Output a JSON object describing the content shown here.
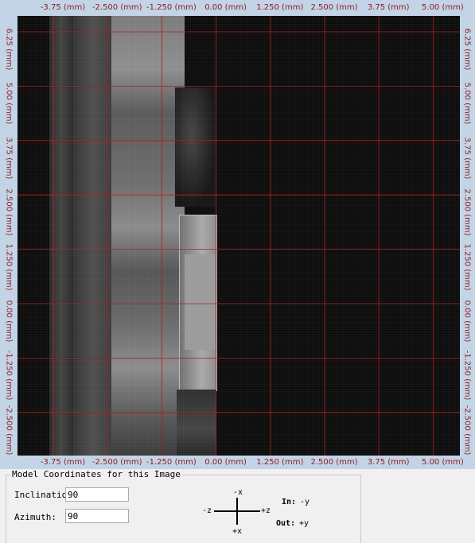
{
  "axes": {
    "top_ticks": [
      "-3.75 (mm)",
      "-2.500 (mm)",
      "-1.250 (mm)",
      "0.00 (mm)",
      "1.250 (mm)",
      "2.500 (mm)",
      "3.75 (mm)",
      "5.00 (mm)"
    ],
    "bottom_ticks": [
      "-3.75 (mm)",
      "-2.500 (mm)",
      "-1.250 (mm)",
      "0.00 (mm)",
      "1.250 (mm)",
      "2.500 (mm)",
      "3.75 (mm)",
      "5.00 (mm)"
    ],
    "left_ticks": [
      "6.25 (mm)",
      "5.00 (mm)",
      "3.75 (mm)",
      "2.500 (mm)",
      "1.250 (mm)",
      "0.00 (mm)",
      "-1.250 (mm)",
      "-2.500 (mm)"
    ],
    "right_ticks": [
      "6.25 (mm)",
      "5.00 (mm)",
      "3.75 (mm)",
      "2.500 (mm)",
      "1.250 (mm)",
      "0.00 (mm)",
      "-1.250 (mm)",
      "-2.500 (mm)"
    ],
    "grid_color": "#b02020",
    "label_color": "#8b1c1c"
  },
  "panel": {
    "title": "Model Coordinates for this Image",
    "inclination_label": "Inclination:",
    "inclination_value": "90",
    "azimuth_label": "Azimuth:",
    "azimuth_value": "90",
    "compass": {
      "top": "-x",
      "bottom": "+x",
      "left": "-z",
      "right": "+z"
    },
    "in_label": "In:",
    "in_value": "-y",
    "out_label": "Out:",
    "out_value": "+y"
  }
}
